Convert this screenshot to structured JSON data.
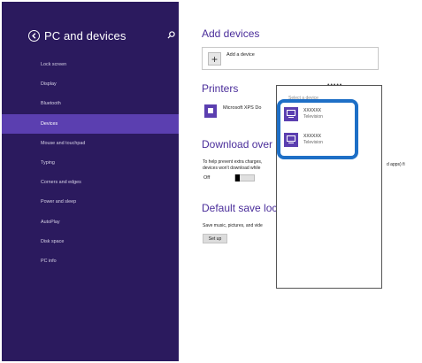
{
  "sidebar": {
    "title": "PC and devices",
    "items": [
      {
        "label": "Lock screen"
      },
      {
        "label": "Display"
      },
      {
        "label": "Bluetooth"
      },
      {
        "label": "Devices"
      },
      {
        "label": "Mouse and touchpad"
      },
      {
        "label": "Typing"
      },
      {
        "label": "Corners and edges"
      },
      {
        "label": "Power and sleep"
      },
      {
        "label": "AutoPlay"
      },
      {
        "label": "Disk space"
      },
      {
        "label": "PC info"
      }
    ],
    "active_item": "Devices",
    "accent_color": "#2b1a5e",
    "active_color": "#5b3fb0"
  },
  "main": {
    "add_devices_heading": "Add devices",
    "add_device_label": "Add a device",
    "printers_heading": "Printers",
    "printer_name": "Microsoft XPS Do",
    "download_heading": "Download over",
    "download_text_1": "To help prevent extra charges,",
    "download_text_2": "devices won't download while",
    "download_text_right": "d apps) fi",
    "toggle_state": "Off",
    "default_save_heading": "Default save loca",
    "save_text": "Save music, pictures, and vide",
    "setup_button": "Set up"
  },
  "flyout": {
    "heading": "Select a device",
    "devices": [
      {
        "name": "XXXXXX",
        "type": "Television"
      },
      {
        "name": "XXXXXX",
        "type": "Television"
      }
    ],
    "highlight_color": "#1e6fc6"
  }
}
